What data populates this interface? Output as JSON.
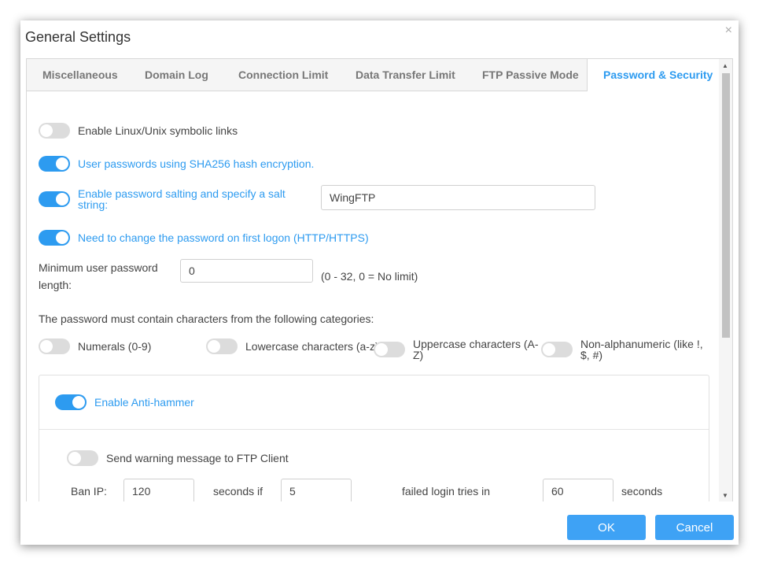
{
  "dialog": {
    "title": "General Settings",
    "close": "×"
  },
  "tabs": [
    {
      "label": "Miscellaneous",
      "active": false
    },
    {
      "label": "Domain Log",
      "active": false
    },
    {
      "label": "Connection Limit",
      "active": false
    },
    {
      "label": "Data Transfer Limit",
      "active": false
    },
    {
      "label": "FTP Passive Mode",
      "active": false
    },
    {
      "label": "Password & Security",
      "active": true
    }
  ],
  "settings": {
    "symlinks": {
      "label": "Enable Linux/Unix symbolic links",
      "on": false
    },
    "sha256": {
      "label": "User passwords using SHA256 hash encryption.",
      "on": true
    },
    "salting": {
      "label_line1": "Enable password salting and specify a salt",
      "label_line2": "string:",
      "on": true,
      "value": "WingFTP"
    },
    "change_first": {
      "label": "Need to change the password on first logon (HTTP/HTTPS)",
      "on": true
    },
    "min_length": {
      "label_line1": "Minimum user password",
      "label_line2": "length:",
      "value": "0",
      "hint": "(0 - 32, 0 = No limit)"
    },
    "categories_heading": "The password must contain characters from the following categories:",
    "numerals": {
      "label": "Numerals (0-9)",
      "on": false
    },
    "lowercase": {
      "label": "Lowercase characters (a-z)",
      "on": false
    },
    "uppercase": {
      "label_line1": "Uppercase characters (A-",
      "label_line2": "Z)",
      "on": false
    },
    "nonalpha": {
      "label_line1": "Non-alphanumeric (like !,",
      "label_line2": "$, #)",
      "on": false
    }
  },
  "antihammer": {
    "enable": {
      "label": "Enable Anti-hammer",
      "on": true
    },
    "warning": {
      "label": "Send warning message to FTP Client",
      "on": false
    },
    "ban_ip_label": "Ban IP:",
    "ban_seconds": "120",
    "seconds_if_label": "seconds if",
    "failed_tries": "5",
    "failed_label": "failed login tries in",
    "window_seconds": "60",
    "seconds_label": "seconds"
  },
  "footer": {
    "ok": "OK",
    "cancel": "Cancel"
  },
  "colors": {
    "accent": "#2d9bf0",
    "button": "#3ea2f5"
  }
}
